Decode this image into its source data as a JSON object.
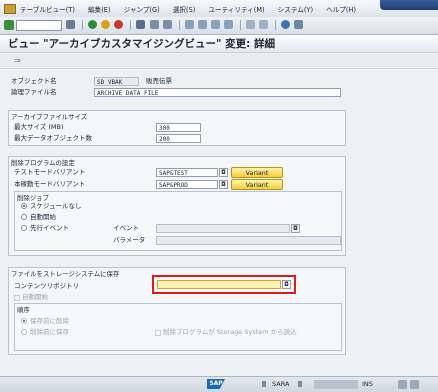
{
  "menu": {
    "items": [
      "テーブルビュー(T)",
      "編集(E)",
      "ジャンプ(G)",
      "選択(S)",
      "ユーティリティ(M)",
      "システム(Y)",
      "ヘルプ(H)"
    ]
  },
  "header": {
    "title": "ビュー \"アーカイブカスタマイジングビュー\" 変更: 詳細"
  },
  "object": {
    "object_name_label": "オブジェクト名",
    "object_name_value": "SD_VBAK",
    "object_desc": "販売伝票",
    "logical_file_label": "論理ファイル名",
    "logical_file_value": "ARCHIVE_DATA_FILE"
  },
  "archive_size": {
    "title": "アーカイブファイルサイズ",
    "max_size_label": "最大サイズ (MB)",
    "max_size_value": "300",
    "max_objects_label": "最大データオブジェクト数",
    "max_objects_value": "200"
  },
  "delete_program": {
    "title": "削除プログラムの設定",
    "test_label": "テストモードバリアント",
    "test_value": "SAP&TEST",
    "prod_label": "本稼動モードバリアント",
    "prod_value": "SAP&PROD",
    "variant_button": "Variant",
    "job": {
      "title": "削除ジョブ",
      "opt_none": "スケジュールなし",
      "opt_auto": "自動開始",
      "opt_event": "先行イベント",
      "event_label": "イベント",
      "param_label": "パラメータ",
      "event_value": "",
      "param_value": ""
    }
  },
  "storage": {
    "title": "ファイルをストレージシステムに保存",
    "repo_label": "コンテンツリポジトリ",
    "repo_value": "",
    "auto_start": "自動開始",
    "sequence": {
      "title": "順序",
      "before_delete": "保存前に削除",
      "after_delete": "削除前に保存",
      "store_system": "削除プログラムが Storage System から読込"
    }
  },
  "status": {
    "system": "SARA",
    "mode": "INS"
  },
  "colors": {
    "highlight_border": "#d81e1e",
    "required_field": "#fdf3b0",
    "button": "#f3cf3f"
  }
}
